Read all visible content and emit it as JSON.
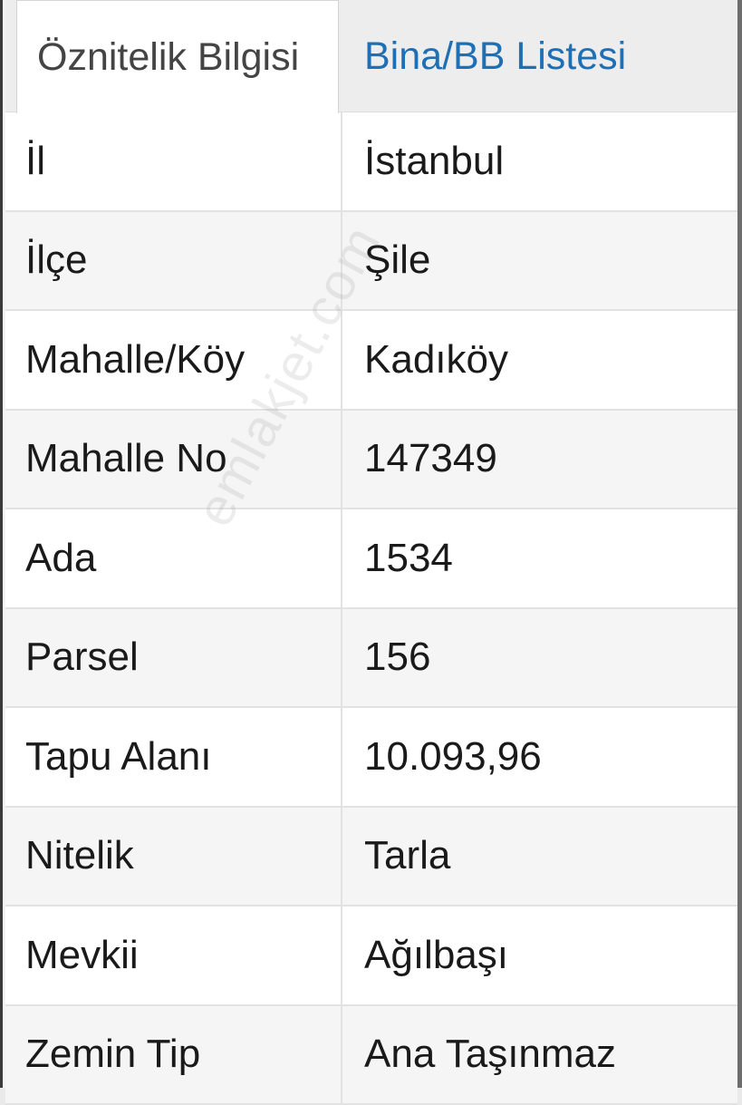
{
  "tabs": [
    {
      "label": "Öznitelik Bilgisi",
      "active": true
    },
    {
      "label": "Bina/BB Listesi",
      "active": false
    }
  ],
  "rows": [
    {
      "key": "İl",
      "value": "İstanbul"
    },
    {
      "key": "İlçe",
      "value": "Şile"
    },
    {
      "key": "Mahalle/Köy",
      "value": "Kadıköy"
    },
    {
      "key": "Mahalle No",
      "value": "147349"
    },
    {
      "key": "Ada",
      "value": "1534"
    },
    {
      "key": "Parsel",
      "value": "156"
    },
    {
      "key": "Tapu Alanı",
      "value": "10.093,96"
    },
    {
      "key": "Nitelik",
      "value": "Tarla"
    },
    {
      "key": "Mevkii",
      "value": "Ağılbaşı"
    },
    {
      "key": "Zemin Tip",
      "value": "Ana Taşınmaz"
    }
  ],
  "watermark": "emlakjet.com",
  "colors": {
    "tab_inactive_text": "#1f6fb5",
    "tab_active_text": "#444444"
  }
}
